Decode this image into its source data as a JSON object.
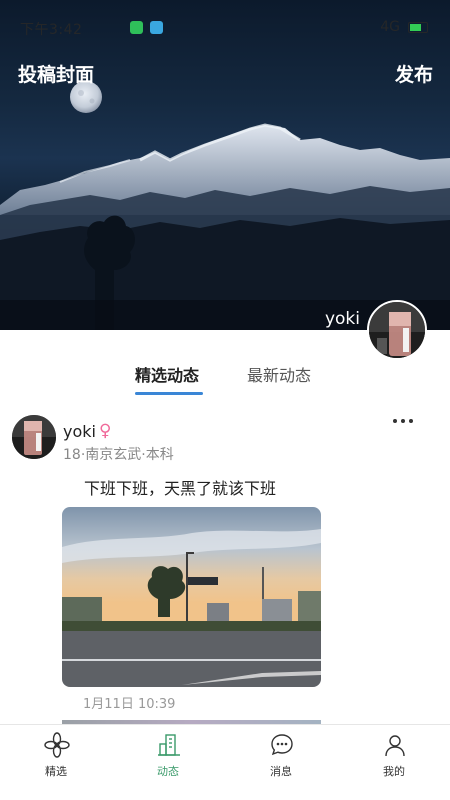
{
  "status_bar": {
    "time": "下午3:42",
    "network": "4G"
  },
  "hero": {
    "cover_label": "投稿封面",
    "publish_label": "发布",
    "username": "yoki"
  },
  "tabs": [
    {
      "label": "精选动态",
      "active": true
    },
    {
      "label": "最新动态",
      "active": false
    }
  ],
  "post": {
    "username": "yoki",
    "gender_symbol": "♀",
    "meta": "18·南京玄武·本科",
    "text": "下班下班，天黑了就该下班",
    "time": "1月11日 10:39"
  },
  "bottom_nav": [
    {
      "label": "精选",
      "icon": "flower-icon",
      "active": false
    },
    {
      "label": "动态",
      "icon": "buildings-icon",
      "active": true
    },
    {
      "label": "消息",
      "icon": "chat-bubble-icon",
      "active": false
    },
    {
      "label": "我的",
      "icon": "person-icon",
      "active": false
    }
  ],
  "colors": {
    "accent": "#3a86d6",
    "active_nav": "#3a9a6a",
    "gender": "#f06a9a"
  }
}
